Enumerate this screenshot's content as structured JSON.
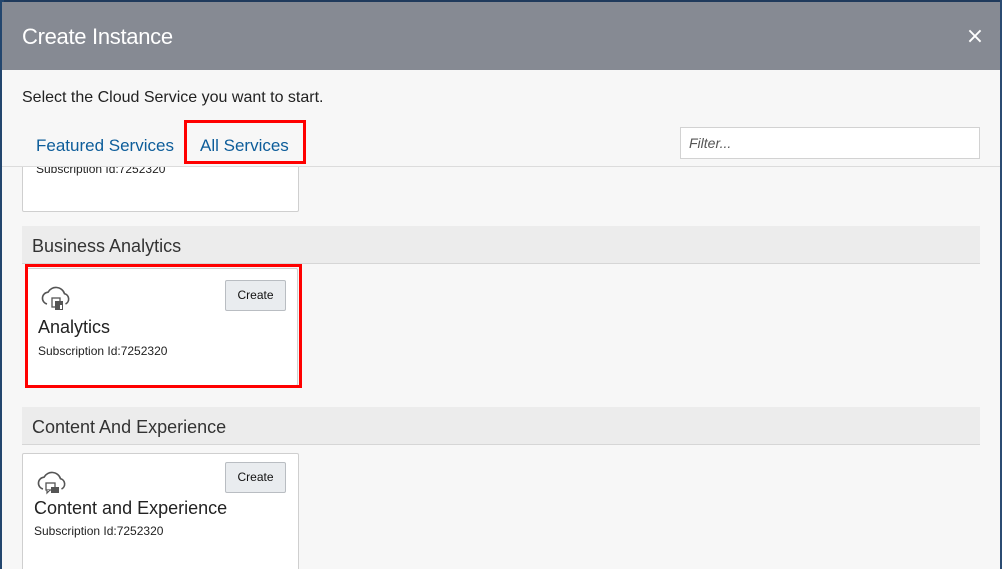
{
  "dialog": {
    "title": "Create Instance",
    "close_label": "×",
    "instruction": "Select the Cloud Service you want to start."
  },
  "tabs": [
    {
      "label": "Featured Services",
      "selected": false
    },
    {
      "label": "All Services",
      "selected": true
    }
  ],
  "filter": {
    "placeholder": "Filter...",
    "value": ""
  },
  "partial_card": {
    "subscription": "Subscription Id:7252320"
  },
  "sections": [
    {
      "title": "Business Analytics",
      "card": {
        "icon": "cloud-analytics-icon",
        "title": "Analytics",
        "subscription": "Subscription Id:7252320",
        "button": "Create"
      }
    },
    {
      "title": "Content And Experience",
      "card": {
        "icon": "cloud-content-icon",
        "title": "Content and Experience",
        "subscription": "Subscription Id:7252320",
        "button": "Create"
      }
    }
  ],
  "colors": {
    "header_bg": "#868a93",
    "tab_link": "#0d5d9a",
    "highlight": "#ff0000"
  }
}
